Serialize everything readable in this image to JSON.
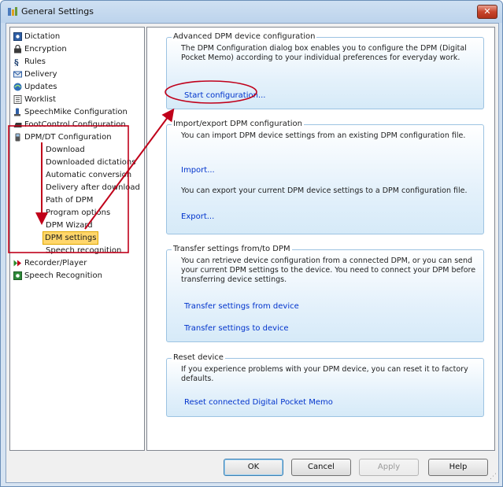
{
  "window": {
    "title": "General Settings",
    "close_label": "✕"
  },
  "tree": {
    "items": [
      {
        "label": "Dictation",
        "icon": "dictation-icon"
      },
      {
        "label": "Encryption",
        "icon": "lock-icon"
      },
      {
        "label": "Rules",
        "icon": "rules-icon"
      },
      {
        "label": "Delivery",
        "icon": "delivery-icon"
      },
      {
        "label": "Updates",
        "icon": "updates-icon"
      },
      {
        "label": "Worklist",
        "icon": "worklist-icon"
      },
      {
        "label": "SpeechMike Configuration",
        "icon": "speechmike-icon"
      },
      {
        "label": "FootControl Configuration",
        "icon": "footcontrol-icon"
      },
      {
        "label": "DPM/DT Configuration",
        "icon": "dpm-icon"
      }
    ],
    "dpm_children": [
      "Download",
      "Downloaded dictations",
      "Automatic conversion",
      "Delivery after download",
      "Path of DPM",
      "Program options",
      "DPM Wizard",
      "DPM settings",
      "Speech recognition"
    ],
    "tail_items": [
      {
        "label": "Recorder/Player",
        "icon": "play-icon"
      },
      {
        "label": "Speech Recognition",
        "icon": "speech-recognition-icon"
      }
    ]
  },
  "groups": {
    "advanced": {
      "title": "Advanced DPM device configuration",
      "text": "The DPM Configuration dialog box enables you to configure the DPM (Digital Pocket Memo) according to your individual preferences for everyday work.",
      "link": "Start configuration..."
    },
    "import_export": {
      "title": "Import/export DPM configuration",
      "import_text": "You can import DPM device settings from an existing DPM configuration file.",
      "import_link": "Import...",
      "export_text": "You can export your current DPM device settings to a DPM configuration file.",
      "export_link": "Export..."
    },
    "transfer": {
      "title": "Transfer settings from/to DPM",
      "text": "You can retrieve device configuration from a connected DPM, or you can send your current DPM settings to the device. You need to connect your DPM before transferring device settings.",
      "link_from": "Transfer settings from device",
      "link_to": "Transfer settings to device"
    },
    "reset": {
      "title": "Reset device",
      "text": "If you experience problems with your DPM device, you can reset it to factory defaults.",
      "link": "Reset connected Digital Pocket Memo"
    }
  },
  "buttons": {
    "ok": "OK",
    "cancel": "Cancel",
    "apply": "Apply",
    "help": "Help"
  },
  "colors": {
    "highlight": "#c0001a",
    "link": "#0033cc",
    "selected": "#ffd66b"
  }
}
